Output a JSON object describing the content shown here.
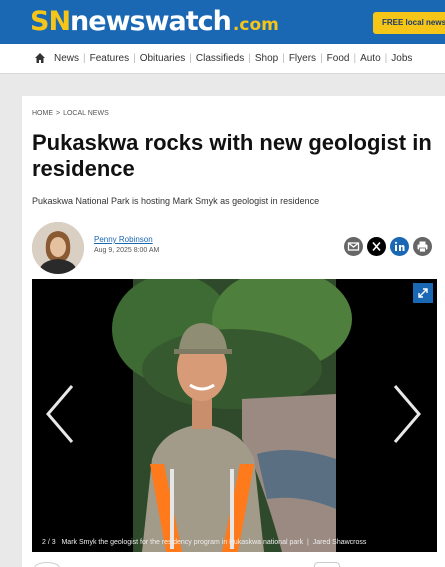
{
  "header": {
    "logo": {
      "part1": "SN",
      "part2": "newswatch",
      "part3": ".com"
    },
    "cta_label": "FREE local newsletter"
  },
  "nav": {
    "items": [
      "News",
      "Features",
      "Obituaries",
      "Classifieds",
      "Shop",
      "Flyers",
      "Food",
      "Auto",
      "Jobs"
    ]
  },
  "breadcrumb": {
    "home": "HOME",
    "separator": ">",
    "section": "LOCAL NEWS"
  },
  "article": {
    "title": "Pukaskwa rocks with new geologist in residence",
    "subtitle": "Pukaskwa National Park is hosting Mark Smyk as geologist in residence",
    "author": "Penny Robinson",
    "date": "Aug 9, 2025 8:00 AM"
  },
  "gallery": {
    "counter": "2 / 3",
    "caption": "Mark Smyk the geologist for the residency program in Pukaskwa national park",
    "credit_separator": "|",
    "credit": "Jared Shawcross"
  },
  "share_icons": [
    "email-icon",
    "x-icon",
    "linkedin-icon",
    "print-icon"
  ],
  "colors": {
    "brand_blue": "#1a67b4",
    "brand_yellow": "#f5c518"
  }
}
